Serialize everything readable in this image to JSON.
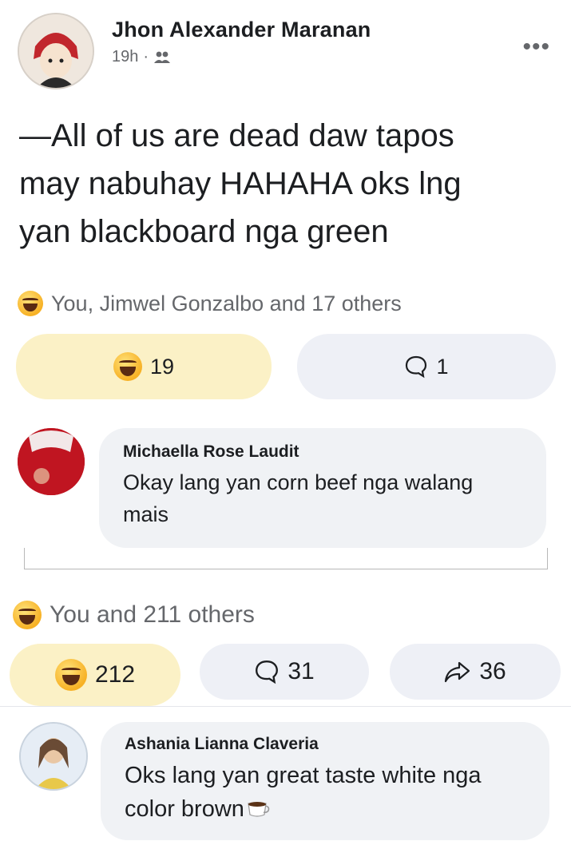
{
  "post": {
    "author": "Jhon Alexander Maranan",
    "time": "19h",
    "separator": "·",
    "audience_icon": "friends-icon",
    "more_icon": "more-dots-icon",
    "lines": [
      "—All of us are dead daw tapos",
      "may nabuhay HAHAHA oks lng",
      "yan blackboard nga green"
    ],
    "reaction_summary": "You, Jimwel Gonzalbo and 17 others",
    "reaction_count": "19",
    "comment_count": "1"
  },
  "comment1": {
    "author": "Michaella Rose Laudit",
    "text": "Okay lang yan corn beef nga walang mais"
  },
  "comment1_stats": {
    "reaction_summary": "You and 211 others",
    "reaction_count": "212",
    "comment_count": "31",
    "share_count": "36"
  },
  "comment2": {
    "author": "Ashania Lianna Claveria",
    "text_line1": "Oks lang yan great taste white nga",
    "text_line2": "color brown"
  },
  "colors": {
    "like_pill": "#fbf1c6",
    "plain_pill": "#eef0f6",
    "bubble": "#f0f2f5",
    "muted_text": "#65676b"
  }
}
